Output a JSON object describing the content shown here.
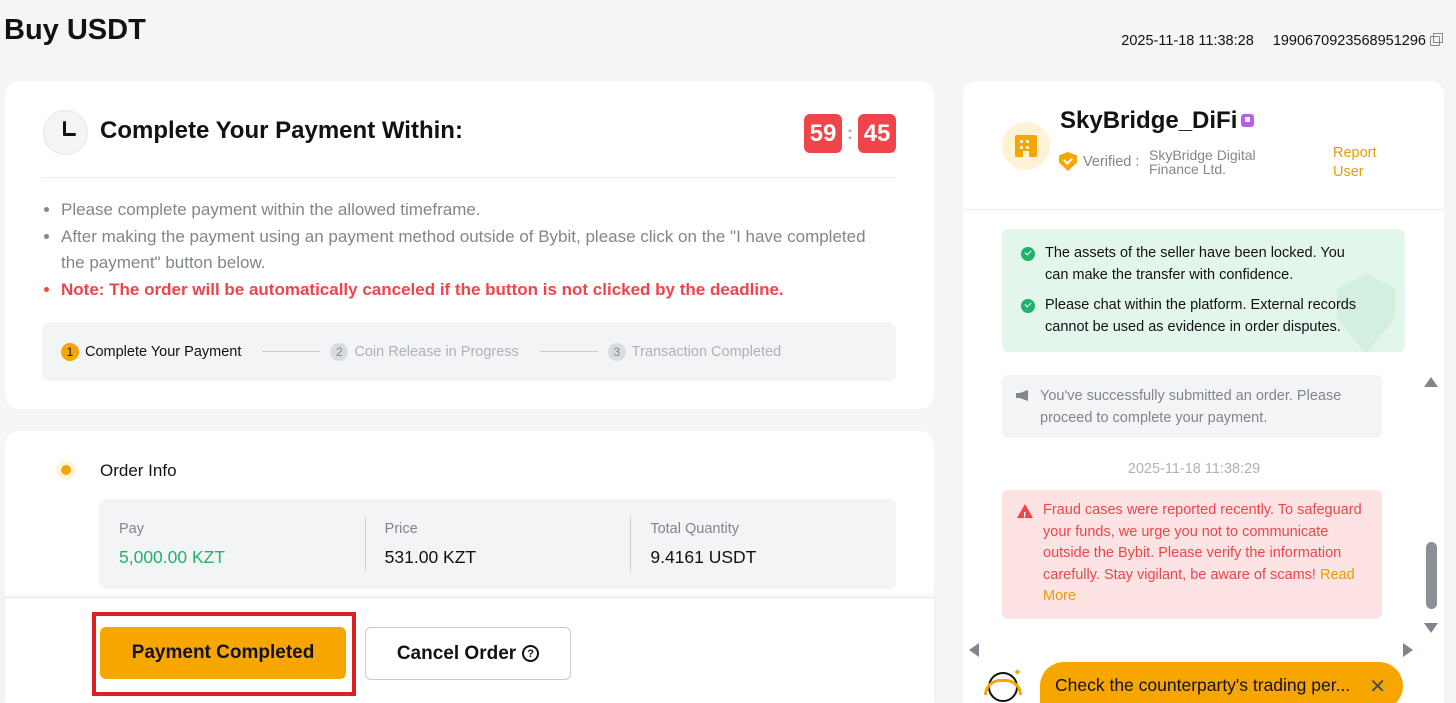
{
  "header": {
    "title": "Buy USDT",
    "timestamp": "2025-11-18 11:38:28",
    "order_id": "1990670923568951296",
    "copy_icon": "copy-icon"
  },
  "timer": {
    "title": "Complete Your Payment Within:",
    "minutes": "59",
    "separator": ":",
    "seconds": "45",
    "notes": [
      "Please complete payment within the allowed timeframe.",
      "After making the payment using an payment method outside of Bybit, please click on the \"I have completed the payment\" button below.",
      "Note: The order will be automatically canceled if the button is not clicked by the deadline."
    ],
    "steps": [
      {
        "num": "1",
        "label": "Complete Your Payment"
      },
      {
        "num": "2",
        "label": "Coin Release in Progress"
      },
      {
        "num": "3",
        "label": "Transaction Completed"
      }
    ]
  },
  "order": {
    "title": "Order Info",
    "pay_label": "Pay",
    "pay_value": "5,000.00 KZT",
    "price_label": "Price",
    "price_value": "531.00 KZT",
    "qty_label": "Total Quantity",
    "qty_value": "9.4161 USDT"
  },
  "actions": {
    "pay_button": "Payment Completed",
    "cancel_button": "Cancel Order",
    "help_glyph": "?"
  },
  "chat": {
    "seller_name": "SkyBridge_DiFi",
    "verified_label": "Verified :",
    "company": "SkyBridge Digital Finance Ltd.",
    "report_label": "Report User",
    "assurances": [
      "The assets of the seller have been locked. You can make the transfer with confidence.",
      "Please chat within the platform. External records cannot be used as evidence in order disputes."
    ],
    "system_message": "You've successfully submitted an order. Please proceed to complete your payment.",
    "message_time": "2025-11-18 11:38:29",
    "fraud_warning": "Fraud cases were reported recently. To safeguard your funds, we urge you not to communicate outside the Bybit. Please verify the information carefully. Stay vigilant, be aware of scams!",
    "read_more": "Read More",
    "tip_text": "Check the counterparty's trading per...",
    "tip_close": "✕",
    "spark_glyph": "✦"
  },
  "colors": {
    "accent": "#f7a600",
    "countdown": "#ef454a",
    "pay_value": "#20b26c",
    "highlight_border": "#e01f1f"
  }
}
